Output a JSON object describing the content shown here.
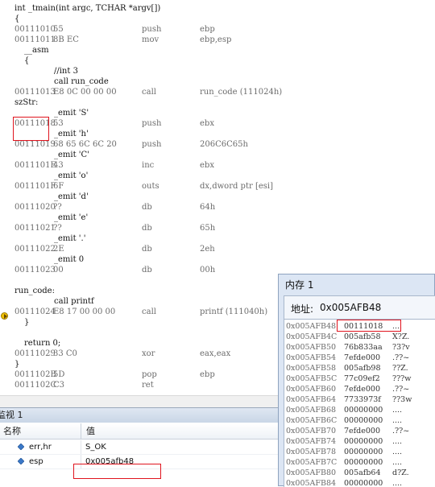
{
  "disassembly": {
    "lines": [
      {
        "kind": "src",
        "indent": 0,
        "text": "int _tmain(int argc, TCHAR *argv[])"
      },
      {
        "kind": "src",
        "indent": 0,
        "text": "{"
      },
      {
        "kind": "asm",
        "addr": "00111010",
        "bytes": "55",
        "mnem": "push",
        "ops": "ebp"
      },
      {
        "kind": "asm",
        "addr": "00111011",
        "bytes": "8B EC",
        "mnem": "mov",
        "ops": "ebp,esp"
      },
      {
        "kind": "src",
        "indent": 1,
        "text": "__asm"
      },
      {
        "kind": "src",
        "indent": 1,
        "text": "{"
      },
      {
        "kind": "src",
        "indent": 2,
        "text": "//int 3"
      },
      {
        "kind": "src",
        "indent": 2,
        "text": "call run_code"
      },
      {
        "kind": "asm",
        "addr": "00111013",
        "bytes": "E8 0C 00 00 00",
        "mnem": "call",
        "ops": "run_code (111024h)"
      },
      {
        "kind": "src",
        "indent": 0,
        "text": "szStr:"
      },
      {
        "kind": "src",
        "indent": 2,
        "text": "_emit 'S'"
      },
      {
        "kind": "asm",
        "addr": "00111018",
        "bytes": "53",
        "mnem": "push",
        "ops": "ebx"
      },
      {
        "kind": "src",
        "indent": 2,
        "text": "_emit 'h'"
      },
      {
        "kind": "asm",
        "addr": "00111019",
        "bytes": "68 65 6C 6C 20",
        "mnem": "push",
        "ops": "206C6C65h"
      },
      {
        "kind": "src",
        "indent": 2,
        "text": "_emit 'C'"
      },
      {
        "kind": "asm",
        "addr": "0011101E",
        "bytes": "43",
        "mnem": "inc",
        "ops": "ebx"
      },
      {
        "kind": "src",
        "indent": 2,
        "text": "_emit 'o'"
      },
      {
        "kind": "asm",
        "addr": "0011101F",
        "bytes": "6F",
        "mnem": "outs",
        "ops": "dx,dword ptr [esi]"
      },
      {
        "kind": "src",
        "indent": 2,
        "text": "_emit 'd'"
      },
      {
        "kind": "asm",
        "addr": "00111020",
        "bytes": "??",
        "mnem": "db",
        "ops": "64h"
      },
      {
        "kind": "src",
        "indent": 2,
        "text": "_emit 'e'"
      },
      {
        "kind": "asm",
        "addr": "00111021",
        "bytes": "??",
        "mnem": "db",
        "ops": "65h"
      },
      {
        "kind": "src",
        "indent": 2,
        "text": "_emit '.'"
      },
      {
        "kind": "asm",
        "addr": "00111022",
        "bytes": "2E",
        "mnem": "db",
        "ops": "2eh"
      },
      {
        "kind": "src",
        "indent": 2,
        "text": "_emit 0"
      },
      {
        "kind": "asm",
        "addr": "00111023",
        "bytes": "00",
        "mnem": "db",
        "ops": "00h"
      },
      {
        "kind": "blank"
      },
      {
        "kind": "src",
        "indent": 0,
        "text": "run_code:"
      },
      {
        "kind": "src",
        "indent": 2,
        "text": "call printf"
      },
      {
        "kind": "asm",
        "addr": "00111024",
        "bytes": "E8 17 00 00 00",
        "mnem": "call",
        "ops": "printf (111040h)"
      },
      {
        "kind": "src",
        "indent": 1,
        "text": "}"
      },
      {
        "kind": "blank"
      },
      {
        "kind": "src",
        "indent": 1,
        "text": "return 0;"
      },
      {
        "kind": "asm",
        "addr": "00111029",
        "bytes": "33 C0",
        "mnem": "xor",
        "ops": "eax,eax"
      },
      {
        "kind": "src",
        "indent": 0,
        "text": "}"
      },
      {
        "kind": "asm",
        "addr": "0011102B",
        "bytes": "5D",
        "mnem": "pop",
        "ops": "ebp"
      },
      {
        "kind": "asm",
        "addr": "0011102C",
        "bytes": "C3",
        "mnem": "ret",
        "ops": ""
      }
    ]
  },
  "watch": {
    "title": "监视 1",
    "col_name": "名称",
    "col_value": "值",
    "rows": [
      {
        "name": "err,hr",
        "value": "S_OK"
      },
      {
        "name": "esp",
        "value": "0x005afb48"
      }
    ]
  },
  "memory": {
    "title": "内存 1",
    "address_label": "地址:",
    "address_value": "0x005AFB48",
    "rows": [
      {
        "addr": "0x005AFB48",
        "value": "00111018",
        "ascii": "...."
      },
      {
        "addr": "0x005AFB4C",
        "value": "005afb58",
        "ascii": "X?Z."
      },
      {
        "addr": "0x005AFB50",
        "value": "76b833aa",
        "ascii": "?3?v"
      },
      {
        "addr": "0x005AFB54",
        "value": "7efde000",
        "ascii": ".??~"
      },
      {
        "addr": "0x005AFB58",
        "value": "005afb98",
        "ascii": "??Z."
      },
      {
        "addr": "0x005AFB5C",
        "value": "77c09ef2",
        "ascii": "???w"
      },
      {
        "addr": "0x005AFB60",
        "value": "7efde000",
        "ascii": ".??~"
      },
      {
        "addr": "0x005AFB64",
        "value": "7733973f",
        "ascii": "??3w"
      },
      {
        "addr": "0x005AFB68",
        "value": "00000000",
        "ascii": "...."
      },
      {
        "addr": "0x005AFB6C",
        "value": "00000000",
        "ascii": "...."
      },
      {
        "addr": "0x005AFB70",
        "value": "7efde000",
        "ascii": ".??~"
      },
      {
        "addr": "0x005AFB74",
        "value": "00000000",
        "ascii": "...."
      },
      {
        "addr": "0x005AFB78",
        "value": "00000000",
        "ascii": "...."
      },
      {
        "addr": "0x005AFB7C",
        "value": "00000000",
        "ascii": "...."
      },
      {
        "addr": "0x005AFB80",
        "value": "005afb64",
        "ascii": "d?Z."
      },
      {
        "addr": "0x005AFB84",
        "value": "00000000",
        "ascii": "...."
      }
    ]
  },
  "colors": {
    "highlight_border": "#e0141e",
    "breakpoint": "#f2c200",
    "memory_frame": "#dce6f4"
  },
  "icons": {
    "breakpoint": "current-instruction-breakpoint-icon",
    "watch_item": "watch-variable-icon"
  }
}
